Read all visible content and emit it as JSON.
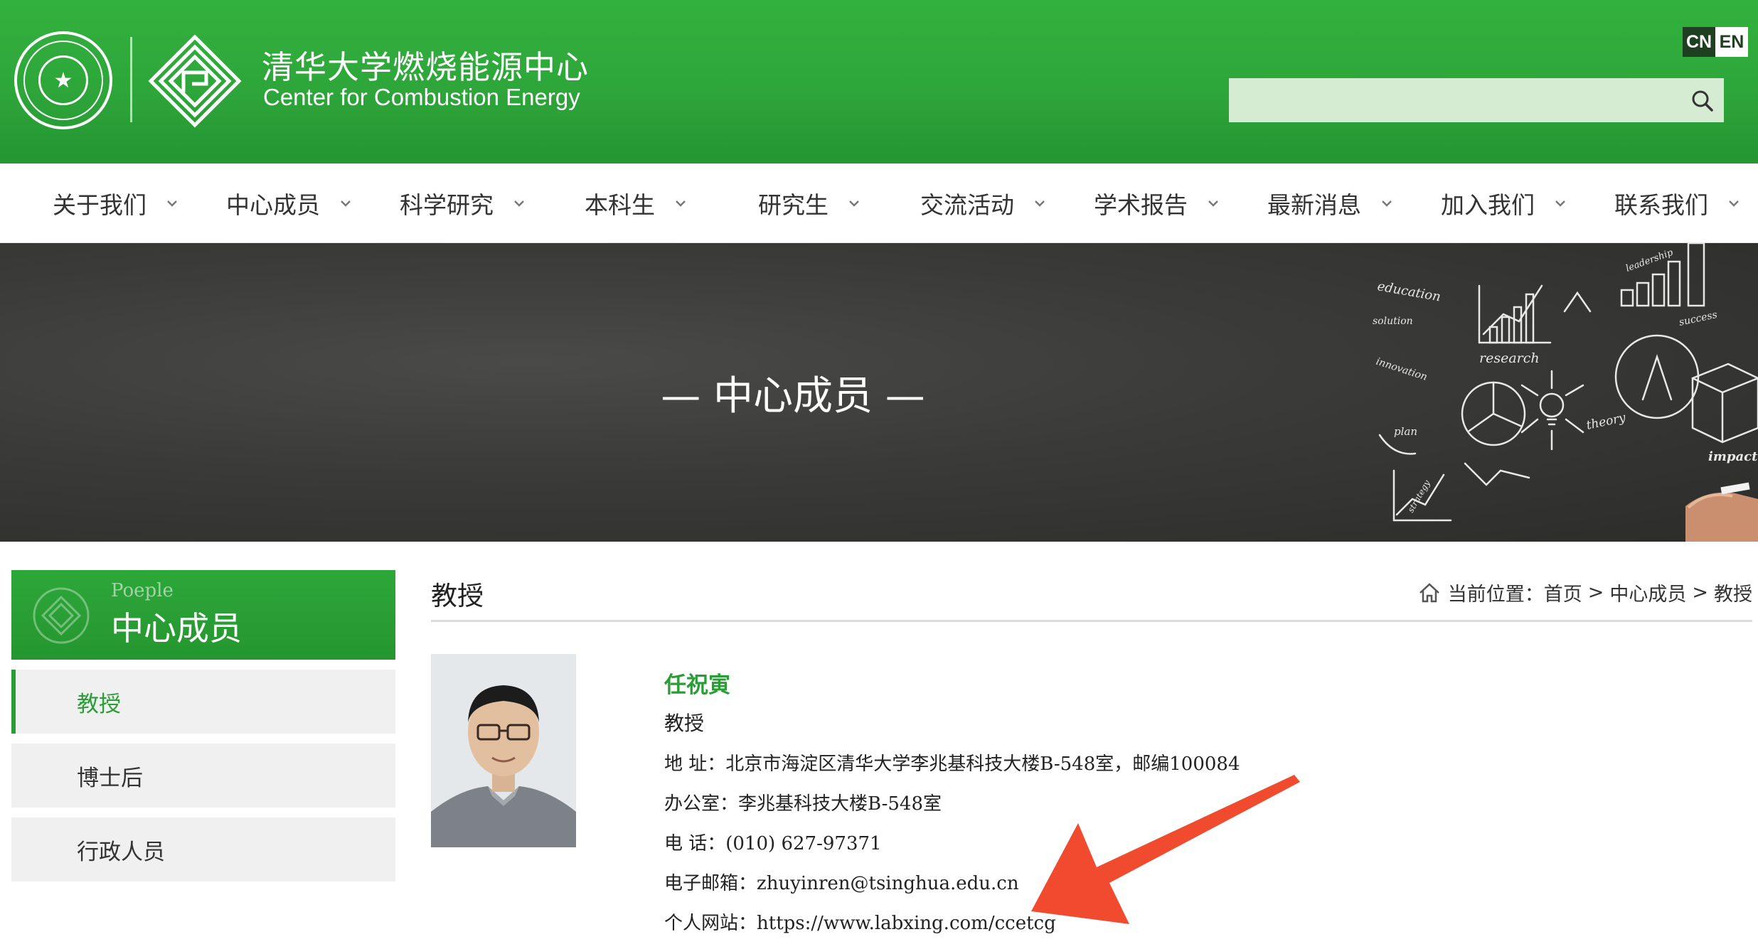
{
  "header": {
    "title_cn": "清华大学燃烧能源中心",
    "title_en": "Center for Combustion Energy",
    "lang": {
      "cn": "CN",
      "en": "EN"
    },
    "search": {
      "placeholder": ""
    }
  },
  "nav": {
    "items": [
      {
        "label": "关于我们"
      },
      {
        "label": "中心成员"
      },
      {
        "label": "科学研究"
      },
      {
        "label": "本科生"
      },
      {
        "label": "研究生"
      },
      {
        "label": "交流活动"
      },
      {
        "label": "学术报告"
      },
      {
        "label": "最新消息"
      },
      {
        "label": "加入我们"
      },
      {
        "label": "联系我们"
      }
    ]
  },
  "banner": {
    "title": "— 中心成员 —",
    "art_words": [
      "education",
      "solution",
      "innovation",
      "plan",
      "research",
      "leadership",
      "success",
      "theory",
      "impact",
      "strategy"
    ]
  },
  "sidebar": {
    "header_en": "Poeple",
    "header_cn": "中心成员",
    "items": [
      {
        "label": "教授",
        "active": true
      },
      {
        "label": "博士后",
        "active": false
      },
      {
        "label": "行政人员",
        "active": false
      }
    ]
  },
  "main": {
    "title": "教授",
    "breadcrumb": {
      "prefix": "当前位置：",
      "items": [
        "首页",
        "中心成员",
        "教授"
      ],
      "separator": ">"
    },
    "person": {
      "name": "任祝寅",
      "position": "教授",
      "address": "地 址：北京市海淀区清华大学李兆基科技大楼B-548室，邮编100084",
      "office": "办公室：李兆基科技大楼B-548室",
      "phone": "电 话：(010) 627-97371",
      "email": "电子邮箱：zhuyinren@tsinghua.edu.cn",
      "website": "个人网站：https://www.labxing.com/ccetcg"
    }
  },
  "colors": {
    "brand_green": "#2da73a",
    "search_bg": "#d6ecd2",
    "lang_dark": "#1e3f20",
    "accent_text": "#2a9d36",
    "annotation_red": "#f04a2f"
  }
}
